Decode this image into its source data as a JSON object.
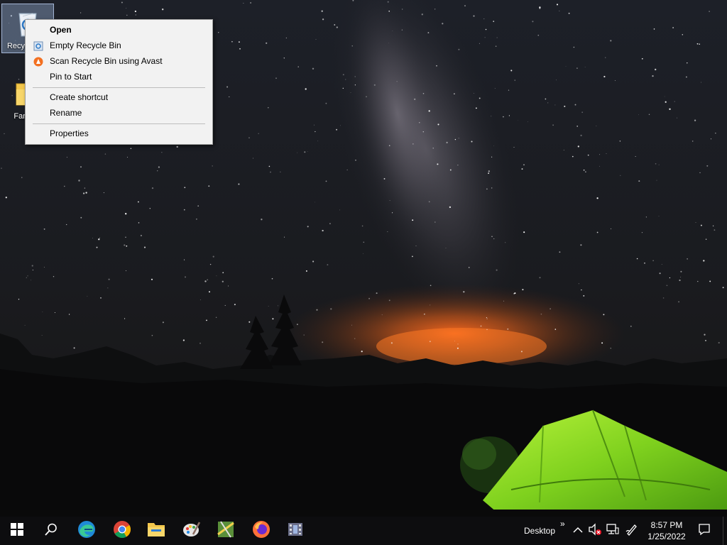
{
  "desktop": {
    "icons": [
      {
        "label": "Recycle Bin",
        "icon": "recycle-bin-icon"
      },
      {
        "label": "Fantasy",
        "icon": "folder-icon"
      }
    ]
  },
  "context_menu": {
    "items": [
      {
        "label": "Open",
        "bold": true
      },
      {
        "label": "Empty Recycle Bin",
        "icon": "recycle-bin-icon"
      },
      {
        "label": "Scan Recycle Bin using Avast",
        "icon": "avast-icon"
      },
      {
        "label": "Pin to Start"
      },
      {
        "label": "Create shortcut"
      },
      {
        "label": "Rename"
      },
      {
        "label": "Properties"
      }
    ]
  },
  "taskbar": {
    "pinned": [
      "start-icon",
      "search-icon",
      "edge-icon",
      "chrome-icon",
      "file-explorer-icon",
      "paint-icon",
      "maps-icon",
      "firefox-icon",
      "video-editor-icon"
    ],
    "desktop_toolbar_label": "Desktop",
    "toolbar_overflow": "»",
    "tray": [
      "show-hidden-icons-chevron",
      "volume-muted-icon",
      "network-icon",
      "pen-icon"
    ],
    "clock": {
      "time": "8:57 PM",
      "date": "1/25/2022"
    },
    "notification_icon": "action-center-icon"
  },
  "colors": {
    "menu_bg": "#f2f2f2",
    "taskbar_bg": "#0d0d0f",
    "tent_green": "#7fd11e",
    "glow_orange": "#c8561a"
  }
}
